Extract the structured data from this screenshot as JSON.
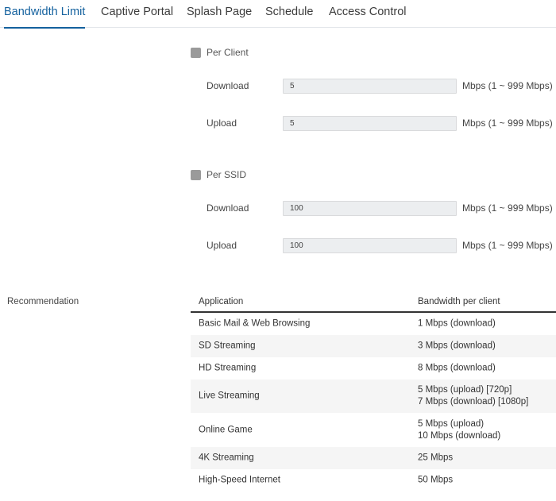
{
  "tabs": [
    {
      "label": "Bandwidth Limit",
      "active": true
    },
    {
      "label": "Captive Portal",
      "active": false
    },
    {
      "label": "Splash Page",
      "active": false
    },
    {
      "label": "Schedule",
      "active": false
    },
    {
      "label": "Access Control",
      "active": false
    }
  ],
  "per_client": {
    "label": "Per Client",
    "download": {
      "label": "Download",
      "value": "5",
      "unit": "Mbps (1 ~ 999 Mbps)"
    },
    "upload": {
      "label": "Upload",
      "value": "5",
      "unit": "Mbps (1 ~ 999 Mbps)"
    }
  },
  "per_ssid": {
    "label": "Per SSID",
    "download": {
      "label": "Download",
      "value": "100",
      "unit": "Mbps (1 ~ 999 Mbps)"
    },
    "upload": {
      "label": "Upload",
      "value": "100",
      "unit": "Mbps (1 ~ 999 Mbps)"
    }
  },
  "recommendation": {
    "label": "Recommendation",
    "columns": [
      "Application",
      "Bandwidth per client"
    ],
    "rows": [
      {
        "app": "Basic Mail & Web Browsing",
        "bw": [
          "1 Mbps (download)"
        ]
      },
      {
        "app": "SD Streaming",
        "bw": [
          "3 Mbps (download)"
        ]
      },
      {
        "app": "HD Streaming",
        "bw": [
          "8 Mbps (download)"
        ]
      },
      {
        "app": "Live Streaming",
        "bw": [
          "5 Mbps (upload) [720p]",
          "7 Mbps (download) [1080p]"
        ]
      },
      {
        "app": "Online Game",
        "bw": [
          "5 Mbps (upload)",
          "10 Mbps (download)"
        ]
      },
      {
        "app": "4K Streaming",
        "bw": [
          "25 Mbps"
        ]
      },
      {
        "app": "High-Speed Internet",
        "bw": [
          "50 Mbps"
        ]
      }
    ]
  },
  "colors": {
    "accent": "#14619e",
    "checkbox": "#9a9a9a",
    "input_bg": "#eceef0"
  }
}
